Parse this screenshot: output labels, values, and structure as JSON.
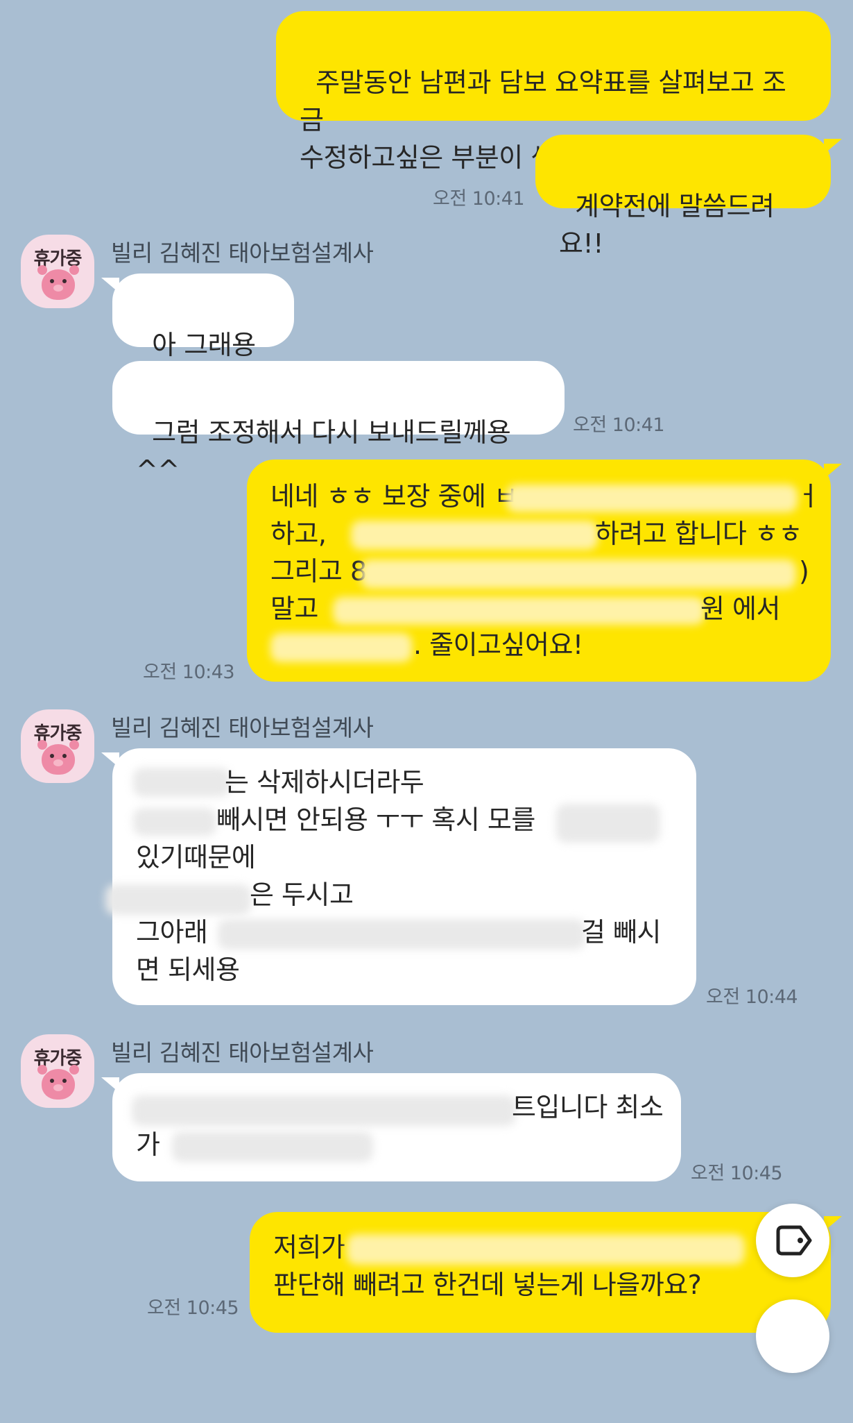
{
  "chat": {
    "sender_name": "빌리 김혜진 태아보험설계사",
    "avatar_badge": "휴가중",
    "messages": [
      {
        "from": "me",
        "text": "주말동안 남편과 담보 요약표를 살펴보고 조금\n수정하고싶은 부분이 생겨서"
      },
      {
        "from": "me",
        "text": "계약전에 말씀드려요!!",
        "time": "오전 10:41"
      },
      {
        "from": "them",
        "text": "아 그래용~?"
      },
      {
        "from": "them",
        "text": "그럼 조정해서 다시 보내드릴께용^^",
        "time": "오전 10:41"
      },
      {
        "from": "me",
        "lines": [
          "네네 ㅎㅎ 보장 중에 ㅂ",
          "ㅓ",
          "하고, ",
          "하려고 합니다 ㅎㅎ",
          "그리고 8",
          ")",
          "말고 ",
          "원 에서",
          ". 줄이고싶어요!"
        ],
        "time": "오전 10:43"
      },
      {
        "from": "them",
        "lines": [
          "는 삭제하시더라두",
          "빼시면 안되용 ㅜㅜ 혹시 모를 ",
          "있기때문에",
          "은 두시고",
          "그아래 ",
          "걸 빼시",
          "면 되세용"
        ],
        "time": "오전 10:44"
      },
      {
        "from": "them",
        "lines": [
          "트입니다 최소",
          "가 "
        ],
        "time": "오전 10:45"
      },
      {
        "from": "me",
        "lines": [
          "저희가 ",
          "판단해 빼려고 한건데 넣는게 나을까요?"
        ],
        "time": "오전 10:45"
      }
    ]
  },
  "colors": {
    "background": "#a9bed2",
    "my_bubble": "#fee500",
    "their_bubble": "#ffffff"
  },
  "icons": {
    "fab_top": "tag-icon"
  }
}
